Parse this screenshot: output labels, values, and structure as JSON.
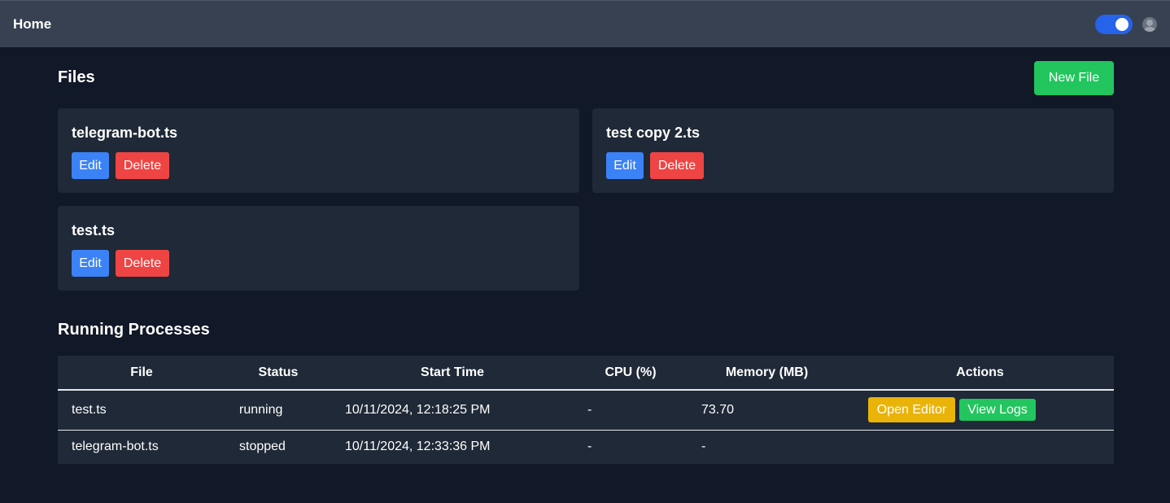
{
  "topbar": {
    "title": "Home",
    "theme_toggle_on": true
  },
  "files": {
    "title": "Files",
    "new_file_label": "New File",
    "items": [
      {
        "name": "telegram-bot.ts",
        "edit_label": "Edit",
        "delete_label": "Delete"
      },
      {
        "name": "test copy 2.ts",
        "edit_label": "Edit",
        "delete_label": "Delete"
      },
      {
        "name": "test.ts",
        "edit_label": "Edit",
        "delete_label": "Delete"
      }
    ]
  },
  "processes": {
    "title": "Running Processes",
    "headers": [
      "File",
      "Status",
      "Start Time",
      "CPU (%)",
      "Memory (MB)",
      "Actions"
    ],
    "rows": [
      {
        "file": "test.ts",
        "status": "running",
        "start_time": "10/11/2024, 12:18:25 PM",
        "cpu": "-",
        "memory": "73.70",
        "open_editor_label": "Open Editor",
        "view_logs_label": "View Logs"
      },
      {
        "file": "telegram-bot.ts",
        "status": "stopped",
        "start_time": "10/11/2024, 12:33:36 PM",
        "cpu": "-",
        "memory": "-"
      }
    ]
  },
  "colors": {
    "background": "#111827",
    "topbar": "#374151",
    "card": "#1f2937",
    "primary": "#3b82f6",
    "danger": "#ef4444",
    "success": "#22c55e",
    "warning": "#eab308"
  }
}
